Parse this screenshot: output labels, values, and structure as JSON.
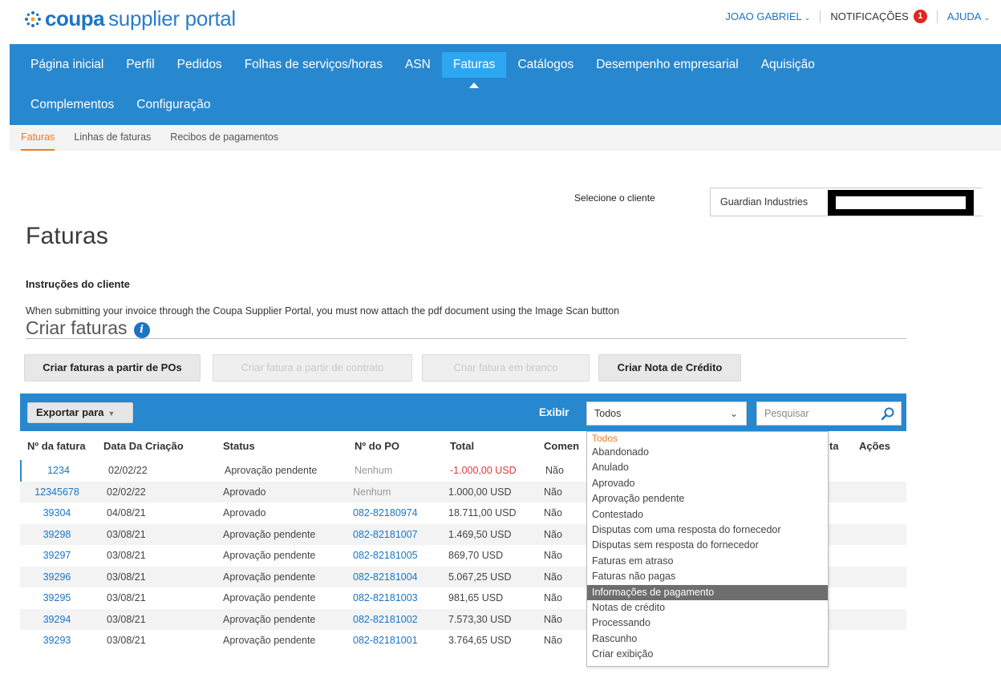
{
  "header": {
    "brand": "coupa",
    "brand_suffix": "supplier portal",
    "user": "JOAO GABRIEL",
    "notifications_label": "NOTIFICAÇÕES",
    "notifications_count": "1",
    "help": "AJUDA"
  },
  "nav": {
    "row1": [
      "Página inicial",
      "Perfil",
      "Pedidos",
      "Folhas de serviços/horas",
      "ASN",
      "Faturas",
      "Catálogos",
      "Desempenho empresarial",
      "Aquisição"
    ],
    "row2": [
      "Complementos",
      "Configuração"
    ],
    "active": "Faturas"
  },
  "subnav": [
    "Faturas",
    "Linhas de faturas",
    "Recibos de pagamentos"
  ],
  "customer": {
    "label": "Selecione o cliente",
    "value": "Guardian Industries"
  },
  "page_title": "Faturas",
  "instructions": {
    "title": "Instruções do cliente",
    "text": "When submitting your invoice through the Coupa Supplier Portal, you must now attach the pdf document using the Image Scan button"
  },
  "create": {
    "title": "Criar faturas",
    "buttons": {
      "from_pos": "Criar faturas a partir de POs",
      "from_contract": "Criar fatura a partir de contrato",
      "blank": "Criar fatura em branco",
      "credit_note": "Criar Nota de Crédito"
    }
  },
  "toolbar": {
    "export": "Exportar para",
    "show_label": "Exibir",
    "show_value": "Todos",
    "search_placeholder": "Pesquisar"
  },
  "table": {
    "headers": {
      "invoice_no": "Nº da fatura",
      "created": "Data Da Criação",
      "status": "Status",
      "po": "Nº do PO",
      "total": "Total",
      "comments": "Comen",
      "col_hidden": "ta",
      "actions": "Ações"
    },
    "rows": [
      {
        "invoice": "1234",
        "date": "02/02/22",
        "status": "Aprovação pendente",
        "po": "Nenhum",
        "total": "-1.000,00 USD",
        "comments": "Não"
      },
      {
        "invoice": "12345678",
        "date": "02/02/22",
        "status": "Aprovado",
        "po": "Nenhum",
        "total": "1.000,00 USD",
        "comments": "Não"
      },
      {
        "invoice": "39304",
        "date": "04/08/21",
        "status": "Aprovado",
        "po": "082-82180974",
        "total": "18.711,00 USD",
        "comments": "Não"
      },
      {
        "invoice": "39298",
        "date": "03/08/21",
        "status": "Aprovação pendente",
        "po": "082-82181007",
        "total": "1.469,50 USD",
        "comments": "Não"
      },
      {
        "invoice": "39297",
        "date": "03/08/21",
        "status": "Aprovação pendente",
        "po": "082-82181005",
        "total": "869,70 USD",
        "comments": "Não"
      },
      {
        "invoice": "39296",
        "date": "03/08/21",
        "status": "Aprovação pendente",
        "po": "082-82181004",
        "total": "5.067,25 USD",
        "comments": "Não"
      },
      {
        "invoice": "39295",
        "date": "03/08/21",
        "status": "Aprovação pendente",
        "po": "082-82181003",
        "total": "981,65 USD",
        "comments": "Não"
      },
      {
        "invoice": "39294",
        "date": "03/08/21",
        "status": "Aprovação pendente",
        "po": "082-82181002",
        "total": "7.573,30 USD",
        "comments": "Não"
      },
      {
        "invoice": "39293",
        "date": "03/08/21",
        "status": "Aprovação pendente",
        "po": "082-82181001",
        "total": "3.764,65 USD",
        "comments": "Não"
      }
    ]
  },
  "dropdown": {
    "options": [
      "Todos",
      "Abandonado",
      "Anulado",
      "Aprovado",
      "Aprovação pendente",
      "Contestado",
      "Disputas com uma resposta do fornecedor",
      "Disputas sem resposta do fornecedor",
      "Faturas em atraso",
      "Faturas não pagas",
      "Informações de pagamento",
      "Notas de crédito",
      "Processando",
      "Rascunho",
      "Criar exibição"
    ],
    "selected": "Todos",
    "highlighted": "Informações de pagamento"
  },
  "colors": {
    "brand_blue": "#1d74c2",
    "nav_blue": "#2788cf",
    "active_tab": "#2ea7f2",
    "accent_orange": "#f07b25",
    "negative_red": "#d93a3a",
    "badge_red": "#e0261f"
  }
}
